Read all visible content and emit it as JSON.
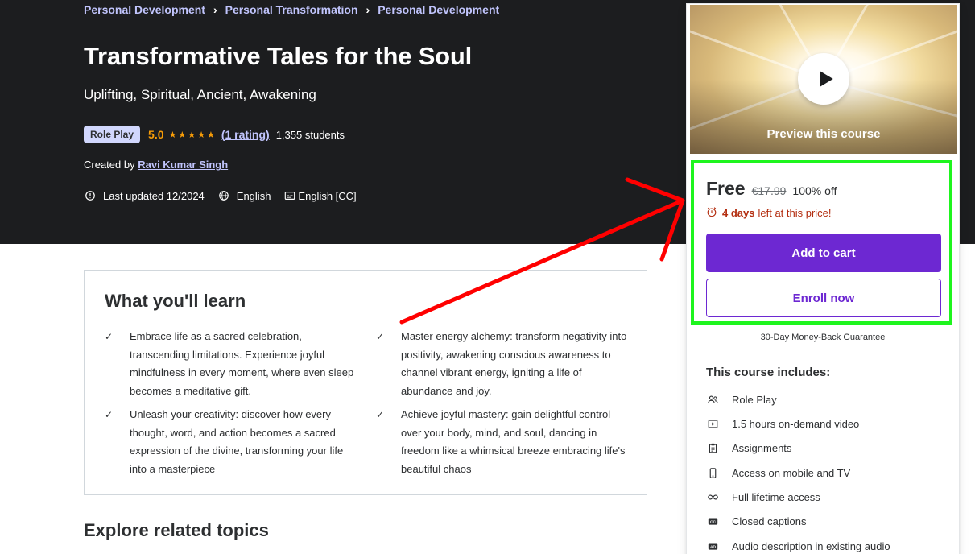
{
  "breadcrumb": [
    {
      "label": "Personal Development"
    },
    {
      "label": "Personal Transformation"
    },
    {
      "label": "Personal Development"
    }
  ],
  "course": {
    "title": "Transformative Tales for the Soul",
    "subtitle": "Uplifting, Spiritual, Ancient, Awakening",
    "badge": "Role Play",
    "rating": "5.0",
    "stars": "★★★★★",
    "rating_count": "(1 rating)",
    "students": "1,355 students",
    "created_by_prefix": "Created by",
    "instructor": "Ravi Kumar Singh",
    "last_updated": "Last updated 12/2024",
    "language": "English",
    "captions": "English [CC]"
  },
  "learn": {
    "title": "What you'll learn",
    "items": [
      "Embrace life as a sacred celebration, transcending limitations. Experience joyful mindfulness in every moment, where even sleep becomes a meditative gift.",
      "Master energy alchemy: transform negativity into positivity, awakening conscious awareness to channel vibrant energy, igniting a life of abundance and joy.",
      "Unleash your creativity: discover how every thought, word, and action becomes a sacred expression of the divine, transforming your life into a masterpiece",
      "Achieve joyful mastery: gain delightful control over your body, mind, and soul, dancing in freedom like a whimsical breeze embracing life's beautiful chaos"
    ],
    "check_glyph": "✓"
  },
  "related": {
    "title": "Explore related topics"
  },
  "sidebar": {
    "preview_label": "Preview this course",
    "price_now": "Free",
    "price_old": "€17.99",
    "discount": "100% off",
    "timer_days": "4 days",
    "timer_suffix": "left at this price!",
    "add_to_cart": "Add to cart",
    "enroll_now": "Enroll now",
    "guarantee": "30-Day Money-Back Guarantee",
    "includes_title": "This course includes:",
    "includes": [
      {
        "label": "Role Play",
        "icon": "people-icon"
      },
      {
        "label": "1.5 hours on-demand video",
        "icon": "video-icon"
      },
      {
        "label": "Assignments",
        "icon": "clipboard-icon"
      },
      {
        "label": "Access on mobile and TV",
        "icon": "mobile-icon"
      },
      {
        "label": "Full lifetime access",
        "icon": "infinity-icon"
      },
      {
        "label": "Closed captions",
        "icon": "cc-icon"
      },
      {
        "label": "Audio description in existing audio",
        "icon": "ad-icon"
      }
    ]
  },
  "colors": {
    "hero_bg": "#1c1d1f",
    "accent_purple": "#6d28d2",
    "link_lavender": "#c0c4fc",
    "star_orange": "#f69c08",
    "timer_red": "#b32d0f",
    "highlight_green": "#1ef51e",
    "arrow_red": "#ff0000"
  }
}
